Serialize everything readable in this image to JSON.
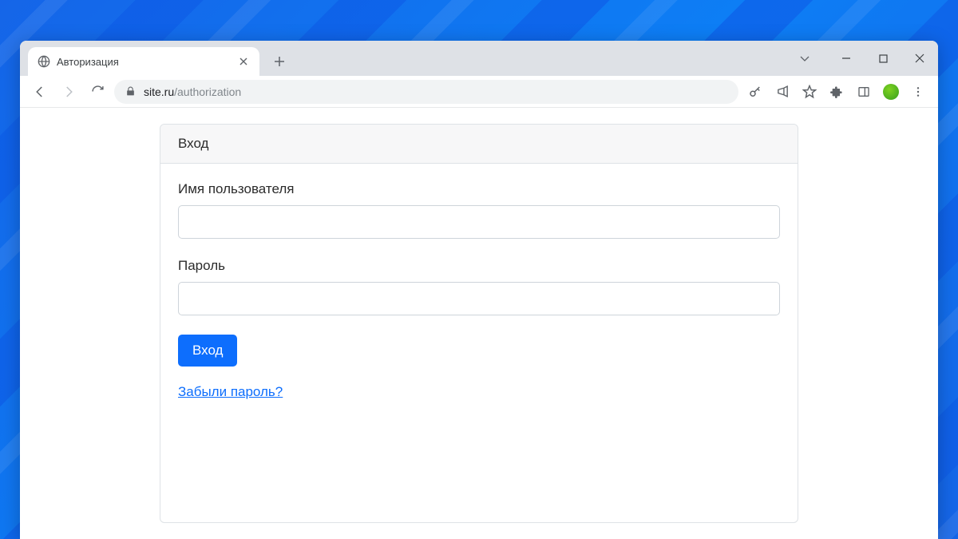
{
  "browser": {
    "tab_title": "Авторизация",
    "url_host": "site.ru",
    "url_path": "/authorization"
  },
  "form": {
    "card_title": "Вход",
    "username_label": "Имя пользователя",
    "username_value": "",
    "password_label": "Пароль",
    "password_value": "",
    "submit_label": "Вход",
    "forgot_label": "Забыли пароль?"
  }
}
